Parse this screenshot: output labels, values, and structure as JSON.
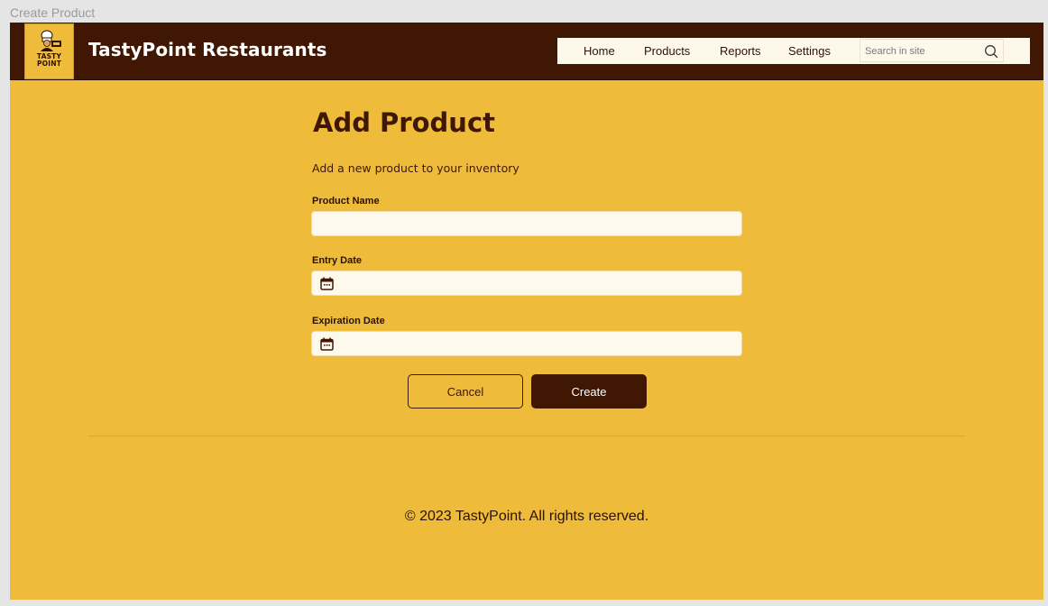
{
  "window": {
    "title": "Create Product"
  },
  "header": {
    "logo_text_line1": "TASTY",
    "logo_text_line2": "POINT",
    "brand": "TastyPoint Restaurants",
    "nav": [
      {
        "label": "Home"
      },
      {
        "label": "Products"
      },
      {
        "label": "Reports"
      },
      {
        "label": "Settings"
      }
    ],
    "search": {
      "placeholder": "Search in site",
      "value": ""
    }
  },
  "form": {
    "title": "Add Product",
    "subtitle": "Add a new product to your inventory",
    "fields": [
      {
        "label": "Product Name",
        "value": ""
      },
      {
        "label": "Entry Date",
        "value": ""
      },
      {
        "label": "Expiration Date",
        "value": ""
      }
    ],
    "cancel_label": "Cancel",
    "create_label": "Create"
  },
  "footer": {
    "text": "© 2023 TastyPoint. All rights reserved."
  },
  "colors": {
    "accent": "#efbb3b",
    "primary_dark": "#401703",
    "field_bg": "#fdf9ec"
  }
}
